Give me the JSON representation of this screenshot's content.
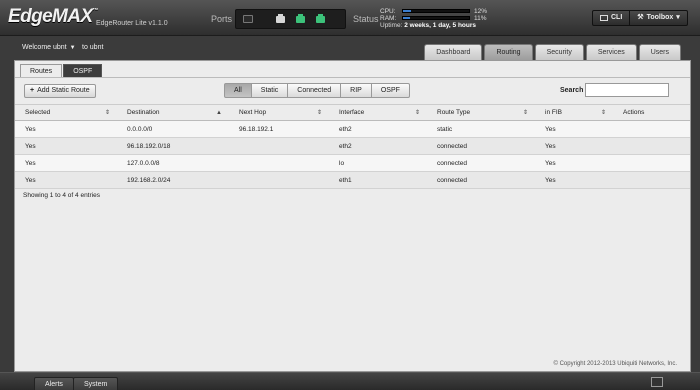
{
  "header": {
    "logo": "EdgeMAX",
    "version": "EdgeRouter Lite v1.1.0",
    "ports_label": "Ports",
    "status_label": "Status",
    "cpu_label": "CPU:",
    "cpu_value": "12%",
    "cpu_level": 0.12,
    "ram_label": "RAM:",
    "ram_value": "11%",
    "ram_level": 0.11,
    "uptime_label": "Uptime:",
    "uptime_value": "2 weeks, 1 day, 5 hours",
    "cli_label": "CLI",
    "toolbox_label": "Toolbox"
  },
  "user": {
    "welcome": "Welcome ubnt",
    "hostname": "to ubnt"
  },
  "nav": {
    "tabs": [
      "Dashboard",
      "Routing",
      "Security",
      "Services",
      "Users"
    ],
    "active": "Routing"
  },
  "subtabs": [
    "Routes",
    "OSPF"
  ],
  "toolbar": {
    "add_label": "Add Static Route",
    "filters": [
      "All",
      "Static",
      "Connected",
      "RIP",
      "OSPF"
    ],
    "active_filter": "All",
    "search_label": "Search",
    "search_value": ""
  },
  "table": {
    "columns": [
      "Selected",
      "Destination",
      "Next Hop",
      "Interface",
      "Route Type",
      "in FIB",
      "Actions"
    ],
    "rows": [
      [
        "Yes",
        "0.0.0.0/0",
        "96.18.192.1",
        "eth2",
        "static",
        "Yes",
        ""
      ],
      [
        "Yes",
        "96.18.192.0/18",
        "",
        "eth2",
        "connected",
        "Yes",
        ""
      ],
      [
        "Yes",
        "127.0.0.0/8",
        "",
        "lo",
        "connected",
        "Yes",
        ""
      ],
      [
        "Yes",
        "192.168.2.0/24",
        "",
        "eth1",
        "connected",
        "Yes",
        ""
      ]
    ],
    "showing": "Showing 1 to 4 of 4 entries"
  },
  "copyright": "© Copyright 2012-2013 Ubiquiti Networks, Inc.",
  "footer": {
    "alerts": "Alerts",
    "system": "System"
  }
}
